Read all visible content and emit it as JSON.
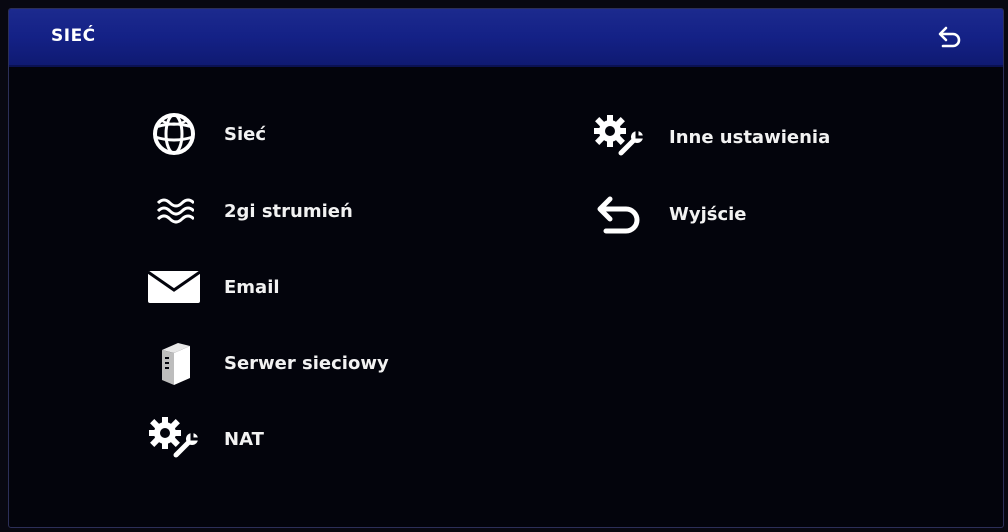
{
  "window": {
    "title": "SIEĆ",
    "back_icon": "return-arrow-icon"
  },
  "menu": {
    "left": [
      {
        "label": "Sieć",
        "icon": "globe-icon"
      },
      {
        "label": "2gi strumień",
        "icon": "waves-icon"
      },
      {
        "label": "Email",
        "icon": "envelope-icon"
      },
      {
        "label": "Serwer sieciowy",
        "icon": "server-icon"
      },
      {
        "label": "NAT",
        "icon": "gear-wrench-icon"
      }
    ],
    "right": [
      {
        "label": "Inne ustawienia",
        "icon": "gear-wrench-icon"
      },
      {
        "label": "Wyjście",
        "icon": "return-arrow-icon"
      }
    ]
  },
  "colors": {
    "titlebar": "#142186",
    "background": "#03040c",
    "text": "#f2f2f2"
  }
}
